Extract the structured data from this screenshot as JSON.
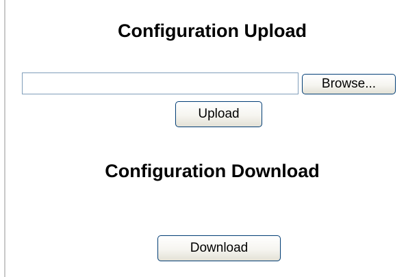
{
  "upload": {
    "title": "Configuration Upload",
    "file_input_value": "",
    "browse_label": "Browse...",
    "upload_label": "Upload"
  },
  "download": {
    "title": "Configuration Download",
    "download_label": "Download"
  }
}
